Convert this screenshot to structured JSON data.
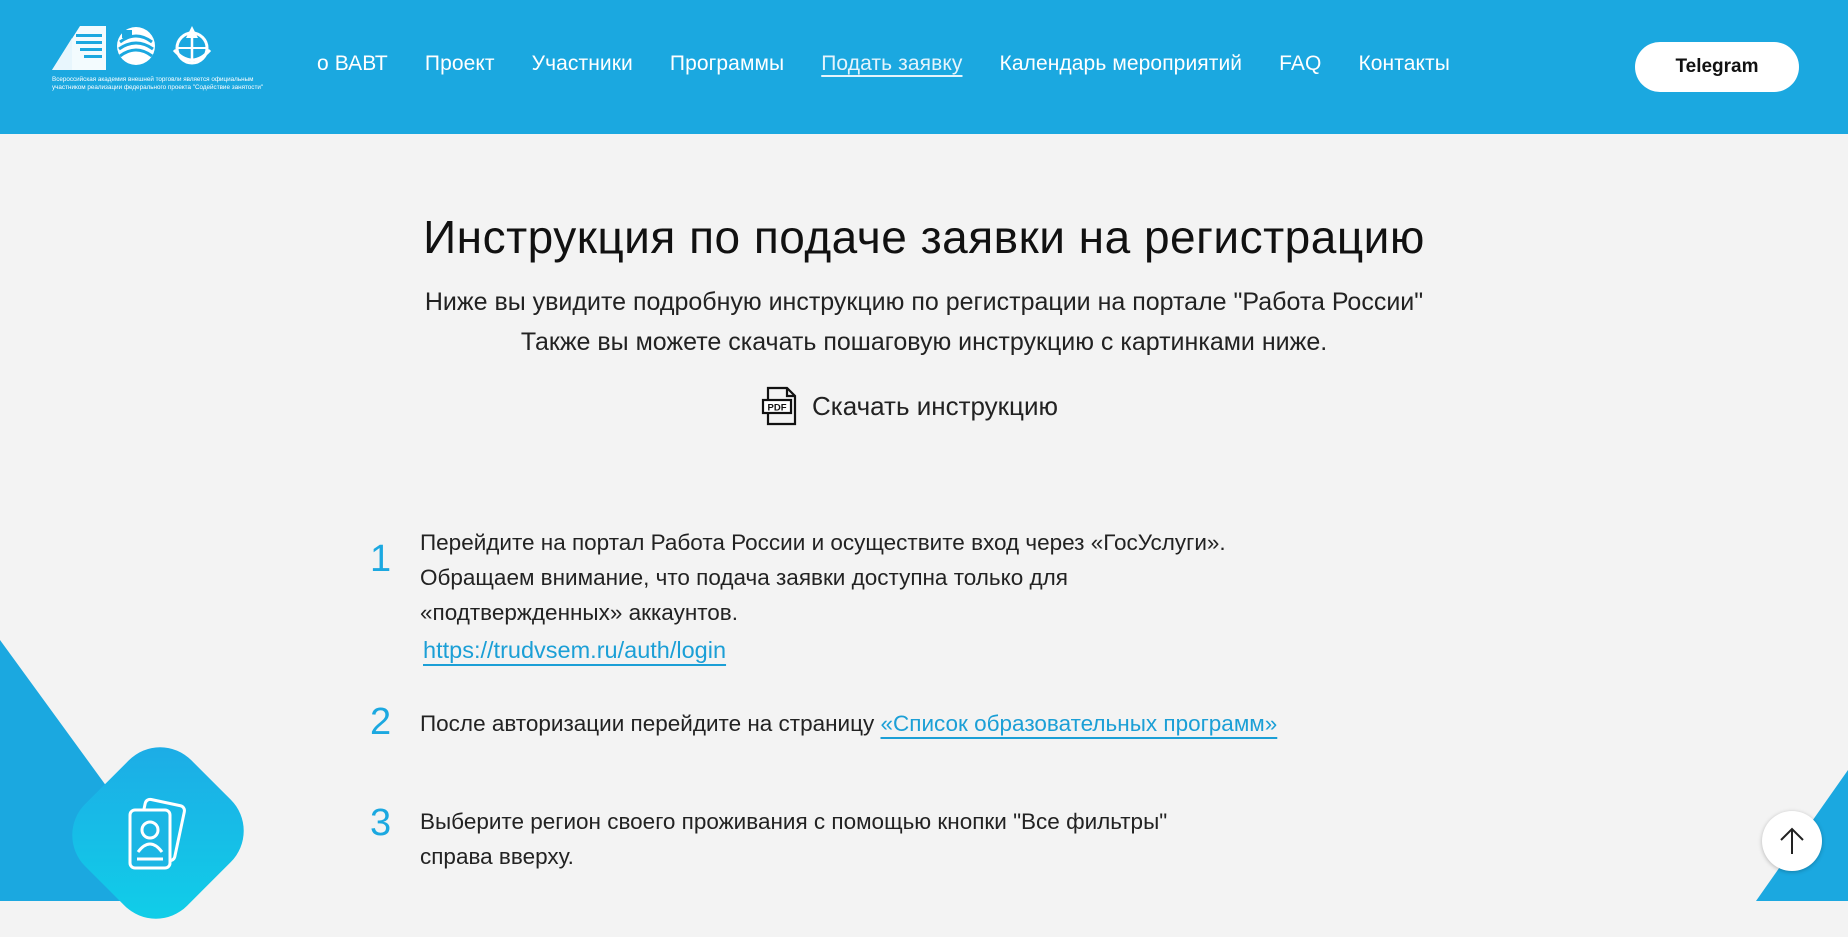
{
  "header": {
    "logo_caption": "Всероссийская академия внешней торговли является официальным участником реализации федерального проекта \"Содействие занятости\"",
    "nav": [
      {
        "label": "о ВАВТ"
      },
      {
        "label": "Проект"
      },
      {
        "label": "Участники"
      },
      {
        "label": "Программы"
      },
      {
        "label": "Подать заявку",
        "active": true
      },
      {
        "label": "Календарь мероприятий"
      },
      {
        "label": "FAQ"
      },
      {
        "label": "Контакты"
      }
    ],
    "telegram_label": "Telegram"
  },
  "main": {
    "title": "Инструкция по подаче заявки на регистрацию",
    "subtitle_line1": "Ниже вы увидите подробную инструкцию по регистрации на портале \"Работа России\"",
    "subtitle_line2": "Также вы можете скачать пошаговую инструкцию с картинками ниже.",
    "download_label": "Скачать инструкцию",
    "pdf_icon_text": "PDF",
    "steps": [
      {
        "num": "1",
        "line1": "Перейдите на портал Работа России и осуществите вход через «ГосУслуги».",
        "line2": "Обращаем внимание, что подача заявки доступна только для",
        "line3": "«подтвержденных» аккаунтов.",
        "link": "https://trudvsem.ru/auth/login"
      },
      {
        "num": "2",
        "text": "После авторизации перейдите на страницу ",
        "link": "«Список образовательных программ»"
      },
      {
        "num": "3",
        "line1": "Выберите регион своего проживания с помощью кнопки \"Все фильтры\"",
        "line2": "справа вверху."
      }
    ]
  },
  "colors": {
    "brand": "#1ba8e0",
    "link": "#1b9fd6",
    "background": "#f3f3f3"
  },
  "icons": [
    "national-projects-logo",
    "vavt-logo",
    "globe-logo",
    "pdf-icon",
    "id-card-icon",
    "arrow-up-icon"
  ]
}
